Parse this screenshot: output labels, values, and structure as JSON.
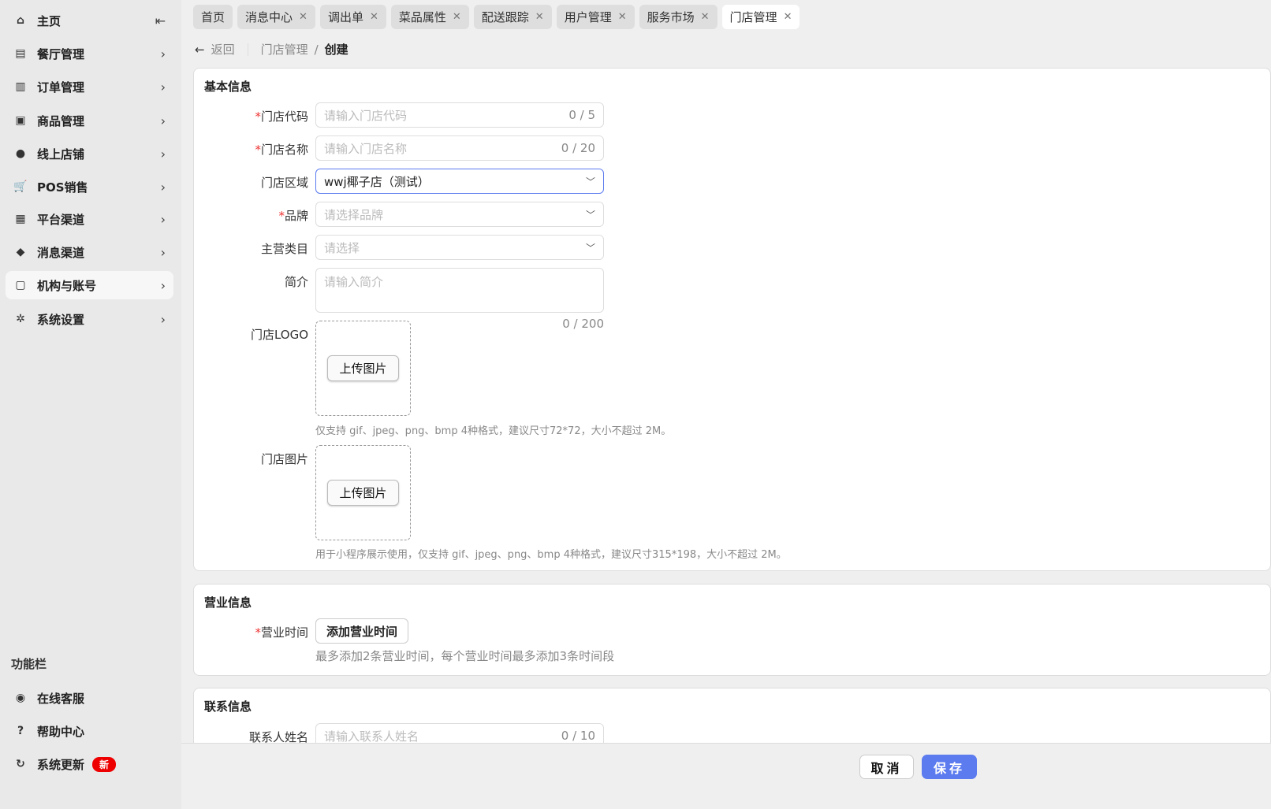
{
  "sidebar": {
    "collapse_icon": "collapse-left-icon",
    "items": [
      {
        "label": "主页",
        "icon": "home-icon"
      },
      {
        "label": "餐厅管理",
        "icon": "shop-icon"
      },
      {
        "label": "订单管理",
        "icon": "order-icon"
      },
      {
        "label": "商品管理",
        "icon": "bag-icon"
      },
      {
        "label": "线上店铺",
        "icon": "globe-icon"
      },
      {
        "label": "POS销售",
        "icon": "cart-icon"
      },
      {
        "label": "平台渠道",
        "icon": "bank-icon"
      },
      {
        "label": "消息渠道",
        "icon": "chat-icon"
      },
      {
        "label": "机构与账号",
        "icon": "id-card-icon"
      },
      {
        "label": "系统设置",
        "icon": "gear-icon"
      }
    ],
    "func_title": "功能栏",
    "func_items": [
      {
        "label": "在线客服",
        "icon": "headset-icon"
      },
      {
        "label": "帮助中心",
        "icon": "help-icon"
      },
      {
        "label": "系统更新",
        "icon": "refresh-icon",
        "badge": "新"
      }
    ]
  },
  "tabs": [
    "首页",
    "消息中心",
    "调出单",
    "菜品属性",
    "配送跟踪",
    "用户管理",
    "服务市场",
    "门店管理"
  ],
  "breadcrumb": {
    "back": "返回",
    "parent": "门店管理",
    "current": "创建"
  },
  "basic": {
    "title": "基本信息",
    "code": {
      "label": "门店代码",
      "placeholder": "请输入门店代码",
      "count": "0 / 5"
    },
    "name": {
      "label": "门店名称",
      "placeholder": "请输入门店名称",
      "count": "0 / 20"
    },
    "region": {
      "label": "门店区域",
      "value": "wwj椰子店（测试）"
    },
    "brand": {
      "label": "品牌",
      "placeholder": "请选择品牌"
    },
    "category": {
      "label": "主营类目",
      "placeholder": "请选择"
    },
    "intro": {
      "label": "简介",
      "placeholder": "请输入简介",
      "count": "0 / 200"
    },
    "logo": {
      "label": "门店LOGO",
      "button": "上传图片",
      "hint": "仅支持 gif、jpeg、png、bmp 4种格式，建议尺寸72*72，大小不超过 2M。"
    },
    "image": {
      "label": "门店图片",
      "button": "上传图片",
      "hint": "用于小程序展示使用，仅支持 gif、jpeg、png、bmp 4种格式，建议尺寸315*198，大小不超过 2M。"
    }
  },
  "business": {
    "title": "营业信息",
    "hours_label": "营业时间",
    "add_button": "添加营业时间",
    "hint": "最多添加2条营业时间，每个营业时间最多添加3条时间段"
  },
  "contact": {
    "title": "联系信息",
    "name_label": "联系人姓名",
    "name_placeholder": "请输入联系人姓名",
    "name_count": "0 / 10"
  },
  "footer": {
    "cancel": "取消",
    "save": "保存"
  },
  "colors": {
    "primary": "#5b7bef",
    "required": "#e33",
    "badge": "#e00"
  }
}
